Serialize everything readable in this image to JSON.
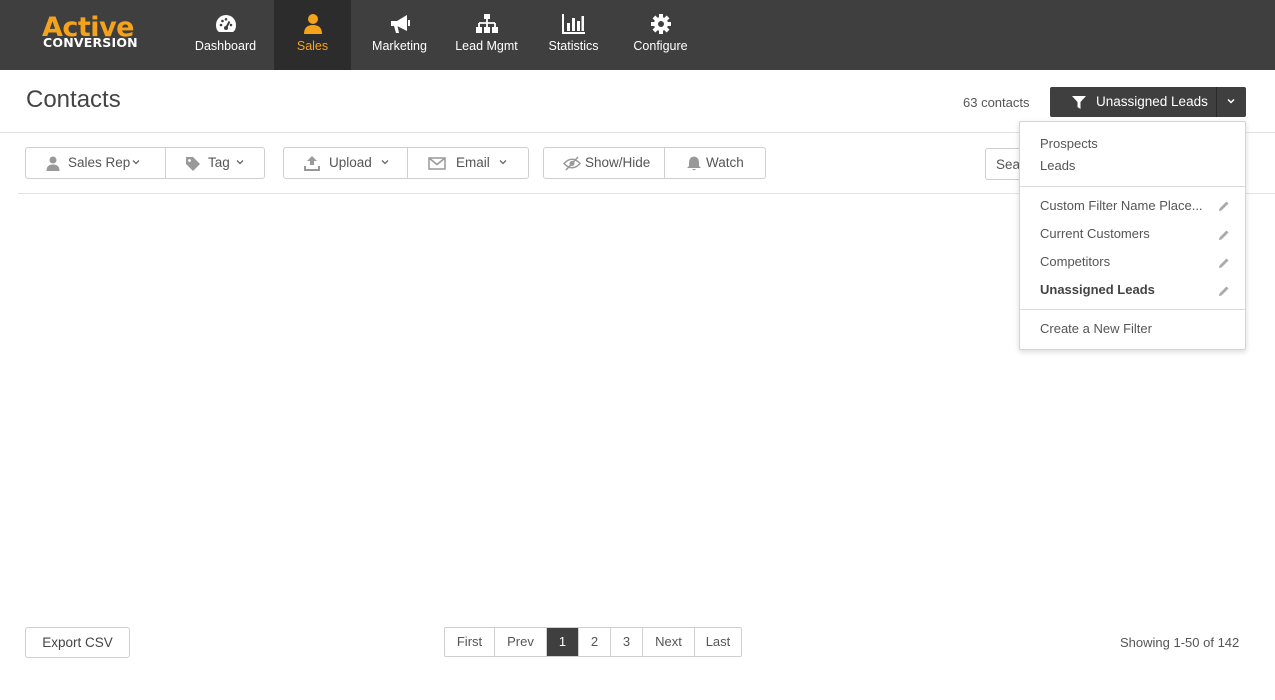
{
  "brand": {
    "line1": "Active",
    "line2": "CONVERSION",
    "accent": "#f5a31a"
  },
  "nav": {
    "items": [
      {
        "label": "Dashboard",
        "icon": "dashboard-gauge-icon"
      },
      {
        "label": "Sales",
        "icon": "user-icon",
        "active": true
      },
      {
        "label": "Marketing",
        "icon": "megaphone-icon"
      },
      {
        "label": "Lead Mgmt",
        "icon": "org-chart-icon"
      },
      {
        "label": "Statistics",
        "icon": "bar-chart-icon"
      },
      {
        "label": "Configure",
        "icon": "gear-icon"
      }
    ]
  },
  "header": {
    "title": "Contacts",
    "count": "63 contacts",
    "filter_label": "Unassigned Leads"
  },
  "toolbar": {
    "sales_rep": "Sales Rep",
    "tag": "Tag",
    "upload": "Upload",
    "email": "Email",
    "show_hide": "Show/Hide",
    "watch": "Watch",
    "search_placeholder": "Sea"
  },
  "dropdown": {
    "default_items": [
      "Prospects",
      "Leads"
    ],
    "custom_items": [
      {
        "label": "Custom Filter Name Place...",
        "bold": false
      },
      {
        "label": "Current Customers",
        "bold": false
      },
      {
        "label": "Competitors",
        "bold": false
      },
      {
        "label": "Unassigned Leads",
        "bold": true
      }
    ],
    "create_label": "Create a New Filter"
  },
  "footer": {
    "export_label": "Export CSV",
    "pager": [
      "First",
      "Prev",
      "1",
      "2",
      "3",
      "Next",
      "Last"
    ],
    "current_page": "1",
    "showing": "Showing 1-50  of 142"
  },
  "colors": {
    "topbar": "#3f3f3f",
    "active_nav": "#2c2c2c",
    "accent": "#f5a31a"
  }
}
